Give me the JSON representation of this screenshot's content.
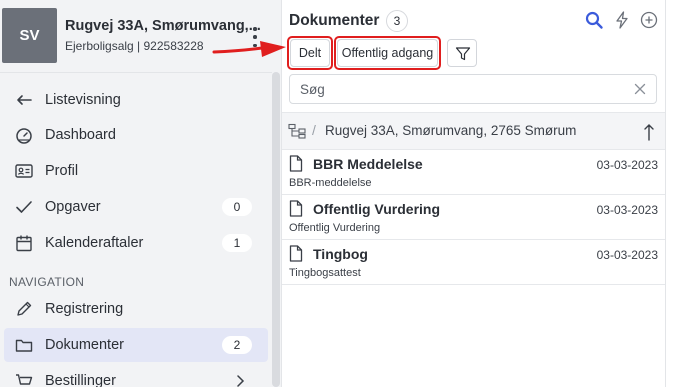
{
  "case": {
    "avatar_initials": "SV",
    "title": "Rugvej 33A, Smørumvang,...",
    "subtitle": "Ejerboligsalg | 922583228"
  },
  "sidebar": {
    "items": [
      {
        "label": "Listevisning",
        "icon": "arrow-left-icon"
      },
      {
        "label": "Dashboard",
        "icon": "gauge-icon"
      },
      {
        "label": "Profil",
        "icon": "id-card-icon"
      },
      {
        "label": "Opgaver",
        "icon": "check-icon",
        "badge": "0"
      },
      {
        "label": "Kalenderaftaler",
        "icon": "calendar-icon",
        "badge": "1"
      }
    ],
    "section_label": "NAVIGATION",
    "nav_items": [
      {
        "label": "Registrering",
        "icon": "pencil-icon"
      },
      {
        "label": "Dokumenter",
        "icon": "folder-icon",
        "badge": "2",
        "active": true
      },
      {
        "label": "Bestillinger",
        "icon": "cart-icon"
      }
    ]
  },
  "main": {
    "title": "Dokumenter",
    "count": "3",
    "filters": [
      "Delt",
      "Offentlig adgang"
    ],
    "search_placeholder": "Søg",
    "path": "Rugvej 33A, Smørumvang, 2765 Smørum",
    "documents": [
      {
        "name": "BBR Meddelelse",
        "type": "BBR-meddelelse",
        "date": "03-03-2023"
      },
      {
        "name": "Offentlig Vurdering",
        "type": "Offentlig Vurdering",
        "date": "03-03-2023"
      },
      {
        "name": "Tingbog",
        "type": "Tingbogsattest",
        "date": "03-03-2023"
      }
    ]
  },
  "colors": {
    "accent": "#3b5bdb",
    "annotation": "#e01e1e",
    "active_bg": "#e3e6f6"
  }
}
